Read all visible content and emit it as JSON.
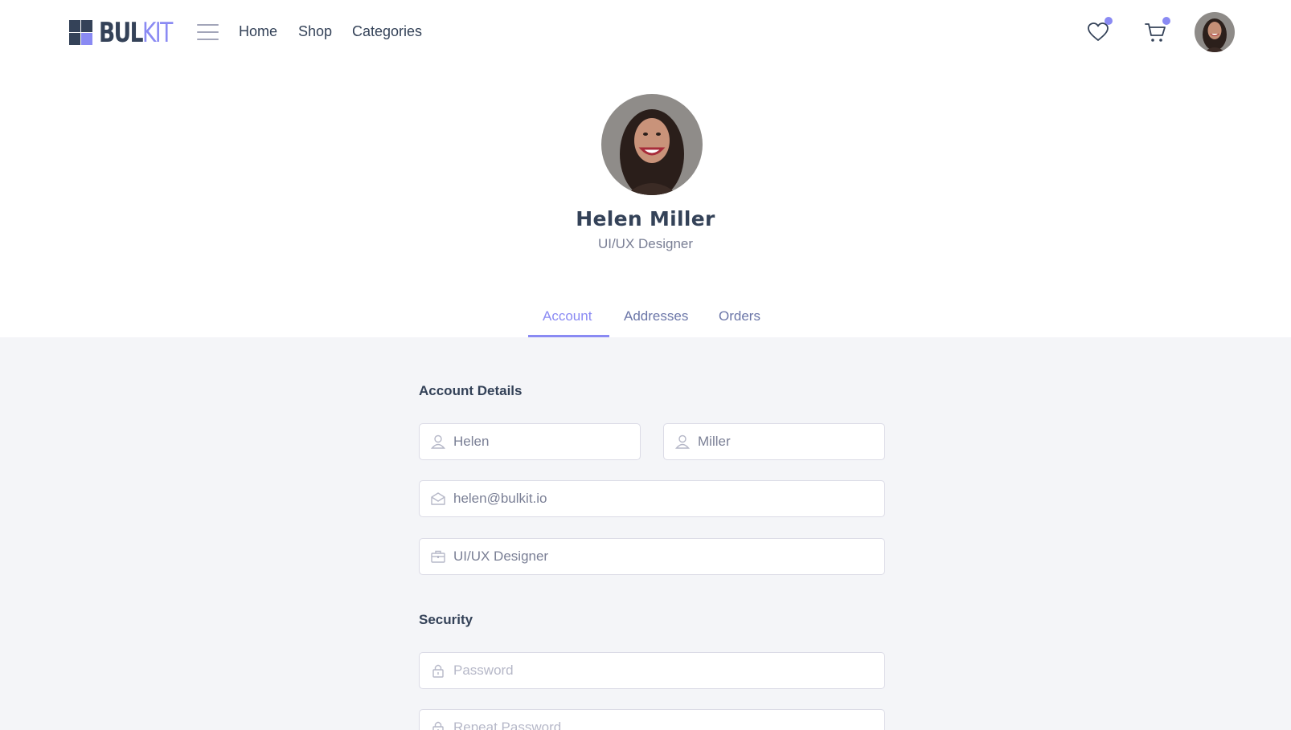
{
  "brand": {
    "part1": "BUL",
    "part2": "KIT"
  },
  "nav": {
    "links": [
      "Home",
      "Shop",
      "Categories"
    ]
  },
  "header_icons": [
    "heart-icon",
    "cart-icon"
  ],
  "colors": {
    "accent": "#8a8af3",
    "text": "#344258",
    "muted": "#7a7f95",
    "page_bg": "#f4f5f8"
  },
  "profile": {
    "name": "Helen Miller",
    "role": "UI/UX Designer"
  },
  "tabs": [
    {
      "label": "Account",
      "active": true
    },
    {
      "label": "Addresses",
      "active": false
    },
    {
      "label": "Orders",
      "active": false
    }
  ],
  "account": {
    "title": "Account Details",
    "first_name": "Helen",
    "last_name": "Miller",
    "email": "helen@bulkit.io",
    "job": "UI/UX Designer"
  },
  "security": {
    "title": "Security",
    "password_placeholder": "Password",
    "repeat_placeholder": "Repeat Password"
  }
}
